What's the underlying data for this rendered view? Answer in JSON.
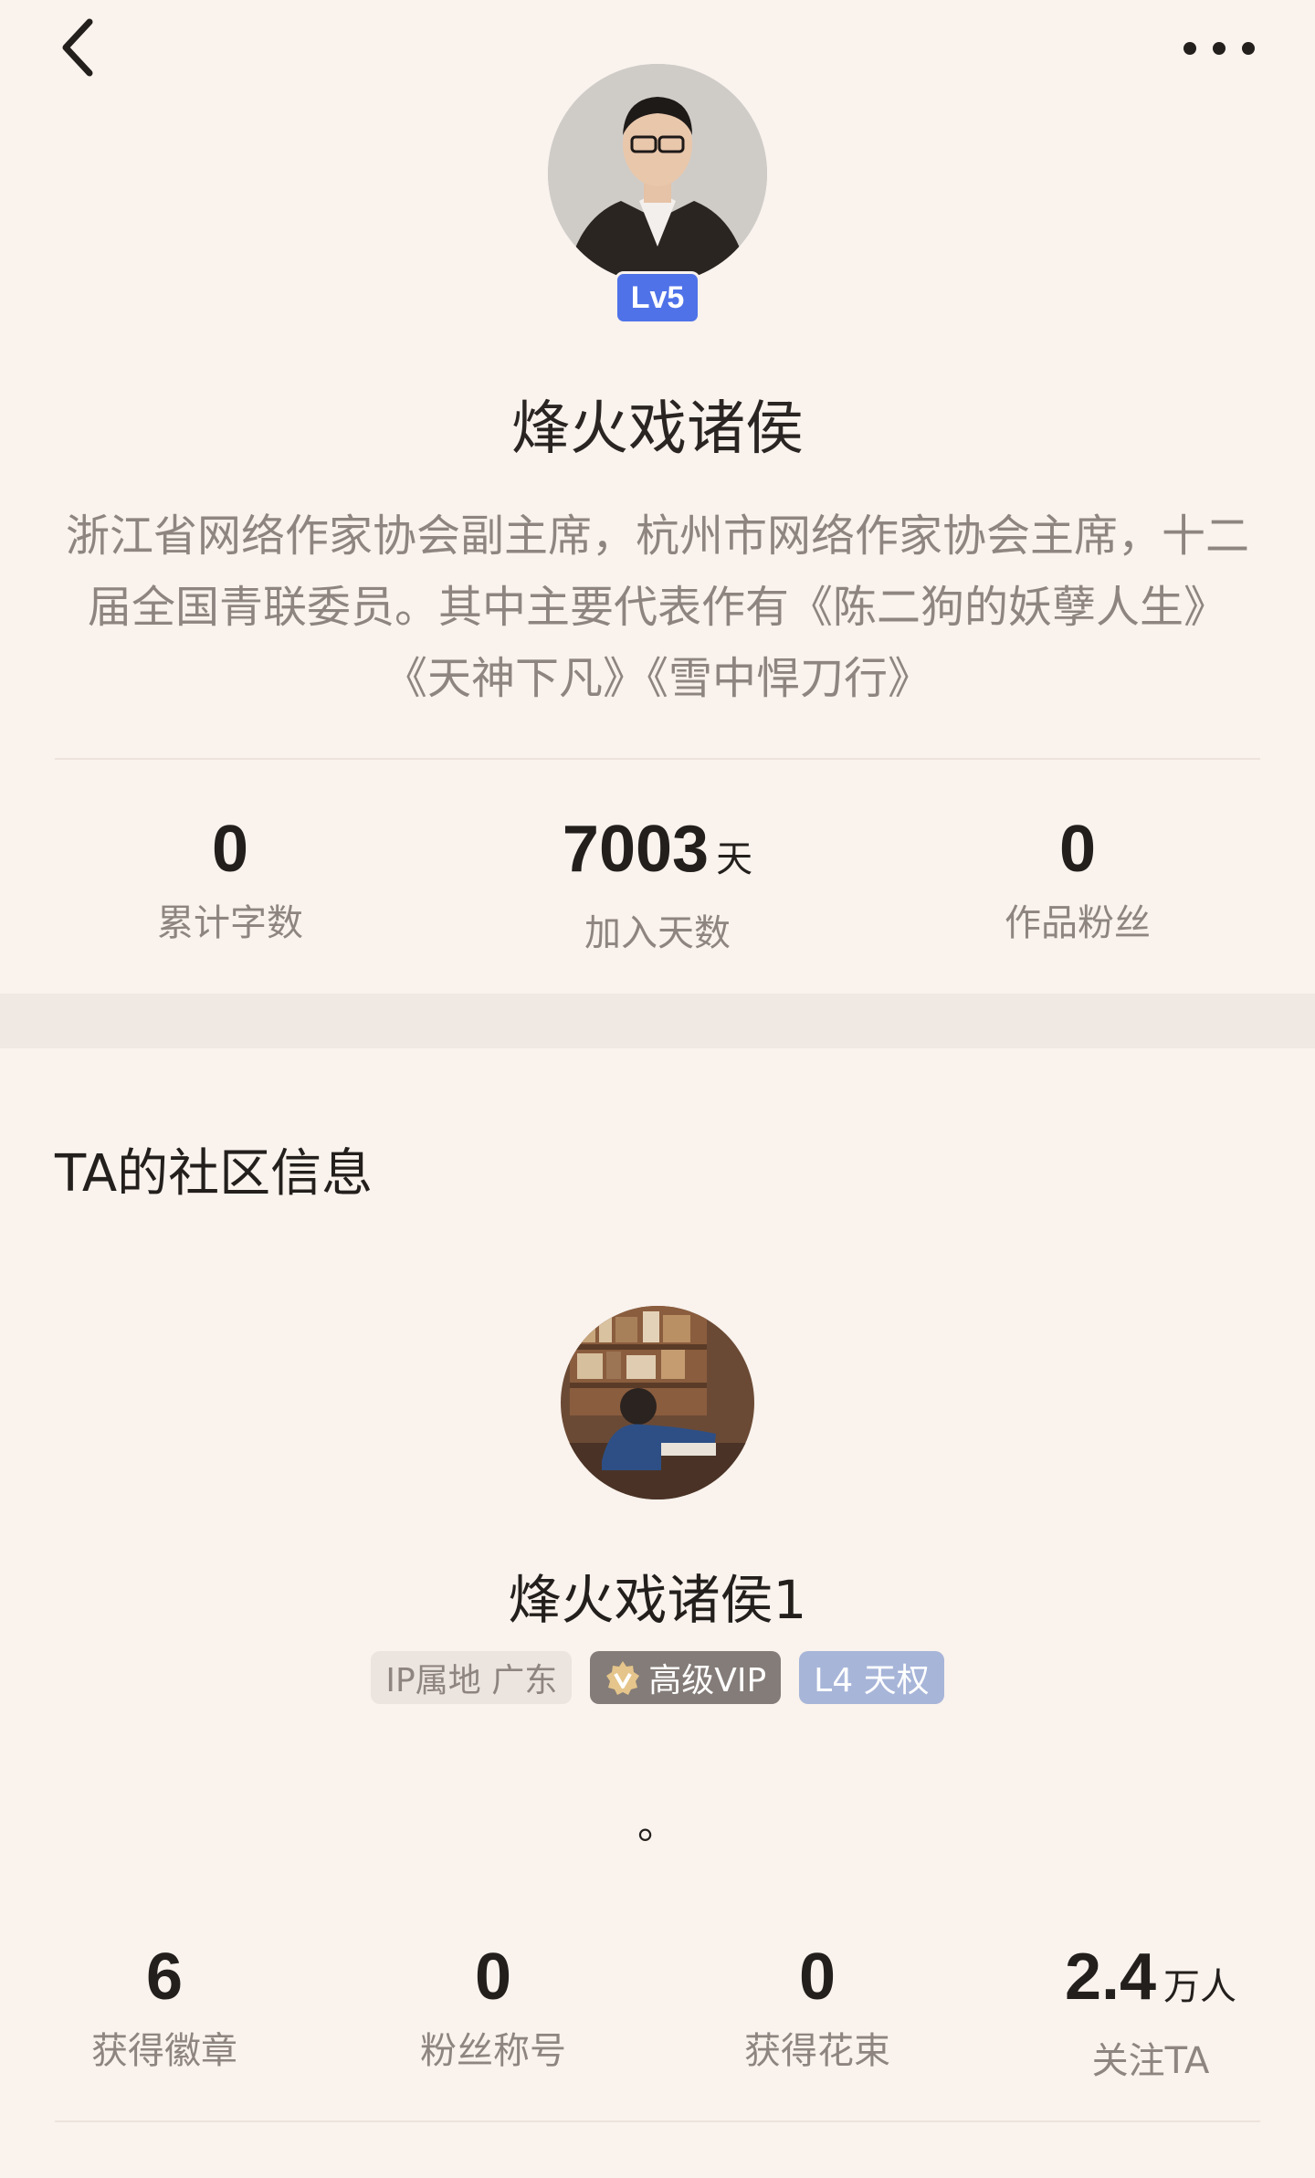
{
  "topbar": {
    "back_icon": "chevron-left-icon",
    "more_icon": "more-horizontal-icon"
  },
  "author": {
    "level_badge": "Lv5",
    "name": "烽火戏诸侯",
    "bio": "浙江省网络作家协会副主席，杭州市网络作家协会主席，十二届全国青联委员。其中主要代表作有《陈二狗的妖孽人生》《天神下凡》《雪中悍刀行》",
    "stats": [
      {
        "value": "0",
        "unit": "",
        "label": "累计字数"
      },
      {
        "value": "7003",
        "unit": "天",
        "label": "加入天数"
      },
      {
        "value": "0",
        "unit": "",
        "label": "作品粉丝"
      }
    ]
  },
  "community": {
    "section_title": "TA的社区信息",
    "name": "烽火戏诸侯1",
    "tags": {
      "ip": "IP属地 广东",
      "vip": "高级VIP",
      "level": "L4 天权"
    },
    "signature": "。",
    "stats": [
      {
        "value": "6",
        "unit": "",
        "label": "获得徽章"
      },
      {
        "value": "0",
        "unit": "",
        "label": "粉丝称号"
      },
      {
        "value": "0",
        "unit": "",
        "label": "获得花束"
      },
      {
        "value": "2.4",
        "unit": "万人",
        "label": "关注TA"
      }
    ]
  },
  "colors": {
    "background": "#f9f2ed",
    "level_badge": "#4f72e8",
    "vip_tag": "#847c78",
    "level_tag": "#a7b5d8",
    "muted_text": "#8e8580"
  }
}
